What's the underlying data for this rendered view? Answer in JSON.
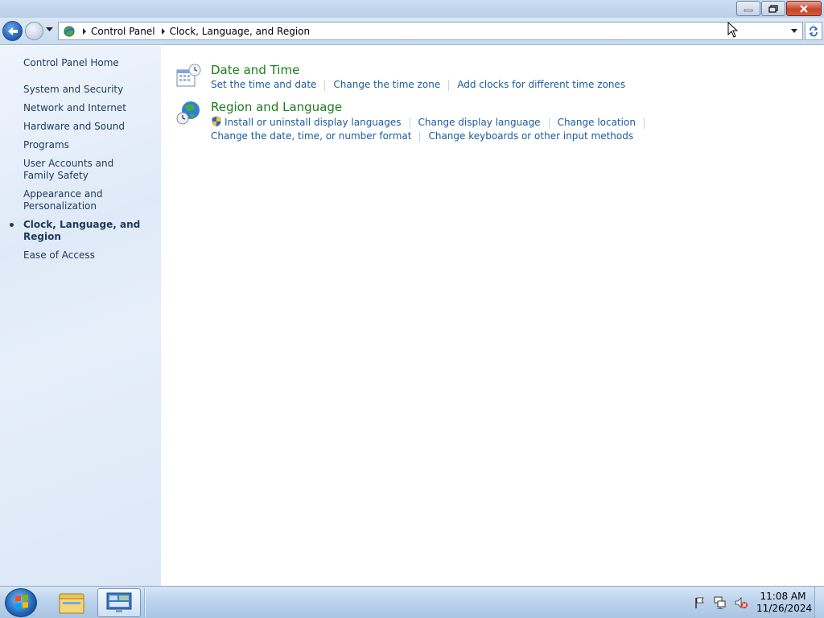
{
  "window": {
    "controls": {
      "minimize": "minimize",
      "restore": "restore",
      "close": "close"
    }
  },
  "navigation": {
    "back_icon": "back-arrow-icon",
    "forward_icon": "forward-arrow-icon",
    "address": {
      "icon": "control-panel-icon",
      "breadcrumbs": [
        "Control Panel",
        "Clock, Language, and Region"
      ]
    },
    "refresh_icon": "refresh-icon"
  },
  "sidebar": {
    "home": "Control Panel Home",
    "items": [
      {
        "label": "System and Security"
      },
      {
        "label": "Network and Internet"
      },
      {
        "label": "Hardware and Sound"
      },
      {
        "label": "Programs"
      },
      {
        "label": "User Accounts and Family Safety"
      },
      {
        "label": "Appearance and Personalization"
      },
      {
        "label": "Clock, Language, and Region",
        "current": true
      },
      {
        "label": "Ease of Access"
      }
    ]
  },
  "main": {
    "categories": [
      {
        "title": "Date and Time",
        "icon": "calendar-clock-icon",
        "rows": [
          [
            "Set the time and date",
            "Change the time zone",
            "Add clocks for different time zones"
          ]
        ]
      },
      {
        "title": "Region and Language",
        "icon": "globe-clock-icon",
        "rows": [
          [
            "Install or uninstall display languages",
            "Change display language",
            "Change location"
          ],
          [
            "Change the date, time, or number format",
            "Change keyboards or other input methods"
          ]
        ]
      }
    ]
  },
  "taskbar": {
    "start_icon": "windows-start-icon",
    "apps": [
      "file-explorer-icon",
      "control-panel-icon"
    ],
    "tray_icons": [
      "action-center-flag-icon",
      "network-icon",
      "volume-muted-icon"
    ],
    "time": "11:08 AM",
    "date": "11/26/2024"
  },
  "colors": {
    "category_title": "#1b7c1b",
    "link": "#1a5a9e",
    "sidebar_text": "#1e395b"
  }
}
